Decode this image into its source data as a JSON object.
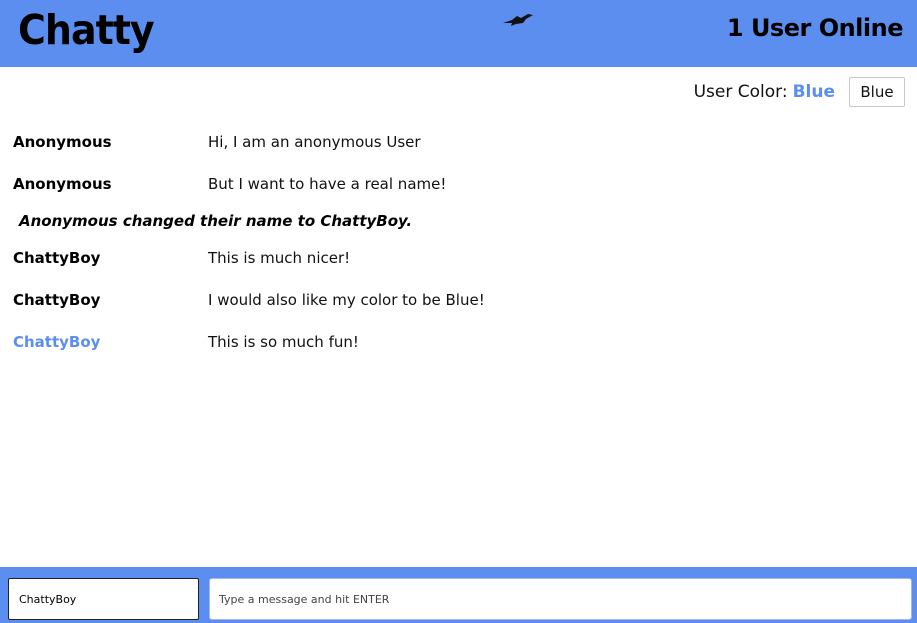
{
  "header": {
    "title": "Chatty",
    "logo_icon": "bird-icon",
    "users_online": "1 User Online"
  },
  "color_setting": {
    "label": "User Color:",
    "value": "Blue",
    "button_label": "Blue",
    "accent_color": "#5b8eee"
  },
  "messages": [
    {
      "type": "message",
      "user": "Anonymous",
      "text": "Hi, I am an anonymous User",
      "user_color": "#000000"
    },
    {
      "type": "message",
      "user": "Anonymous",
      "text": "But I want to have a real name!",
      "user_color": "#000000"
    },
    {
      "type": "system",
      "text": "Anonymous changed their name to ChattyBoy."
    },
    {
      "type": "message",
      "user": "ChattyBoy",
      "text": "This is much nicer!",
      "user_color": "#000000"
    },
    {
      "type": "message",
      "user": "ChattyBoy",
      "text": "I would also like my color to be Blue!",
      "user_color": "#000000"
    },
    {
      "type": "message",
      "user": "ChattyBoy",
      "text": "This is so much fun!",
      "user_color": "#5b8eee"
    }
  ],
  "footer": {
    "name_value": "ChattyBoy",
    "message_placeholder": "Type a message and hit ENTER",
    "background_color": "#5b8eee"
  }
}
